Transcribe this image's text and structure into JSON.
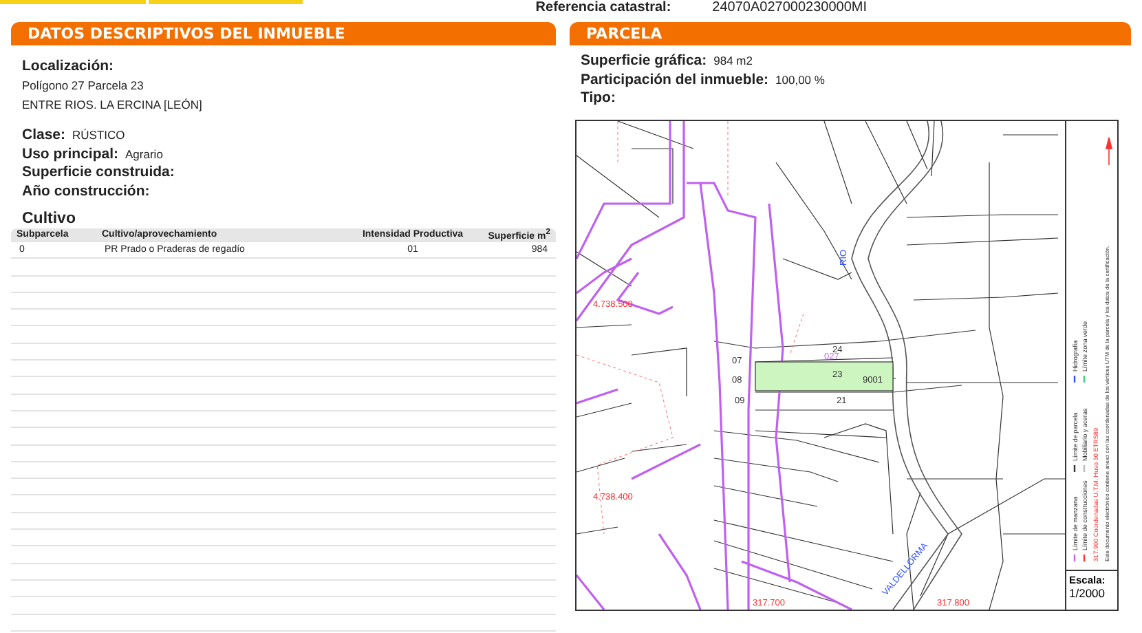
{
  "header": {
    "reference_label": "Referencia catastral:",
    "reference_value": "24070A027000230000MI"
  },
  "left_panel": {
    "title": "DATOS DESCRIPTIVOS DEL",
    "title_bold": "INMUEBLE",
    "location_label": "Localización:",
    "location_lines": [
      "Polígono 27 Parcela 23",
      "ENTRE RIOS. LA ERCINA [LEÓN]"
    ],
    "fields": [
      {
        "label": "Clase:",
        "value": "RÚSTICO"
      },
      {
        "label": "Uso principal:",
        "value": "Agrario"
      },
      {
        "label": "Superficie construida:"
      },
      {
        "label": "Año construcción:"
      }
    ],
    "cultivo": {
      "title": "Cultivo",
      "columns": [
        "Subparcela",
        "Cultivo/aprovechamiento",
        "Intensidad Productiva",
        "Superficie m$^{2}$"
      ],
      "rows": [
        [
          "0",
          "PR Prado o Praderas de regadío",
          "01",
          "984"
        ]
      ]
    }
  },
  "right_panel": {
    "title": "PARCELA",
    "fields": [
      {
        "label": "Superficie gráfica:",
        "value": "984 m2"
      },
      {
        "label": "Participación del inmueble:",
        "value": "100,00 %"
      },
      {
        "label": "Tipo:"
      }
    ],
    "map": {
      "labels": [
        "24",
        "23",
        "21",
        "07",
        "08",
        "09",
        "9001",
        "027",
        "RIO",
        "4.738.500",
        "4.738.400",
        "317.700",
        "317.800",
        "VALDELLORMA"
      ],
      "legend": [
        "Límite de manzana",
        "Límite de construcciones",
        "Límite de parcela",
        "Mobiliario y aceras",
        "Hidrografía",
        "Límite zona verde"
      ],
      "coordinates_note": "317.900 Coordenadas U.T.M. Huso 30 ETRS89",
      "document_note": "Este documento electrónico contiene anexo con las coordenadas de los vértices UTM de la parcela y los datos de la certificación.",
      "scale_label": "Escala:",
      "scale_value": "1/2000"
    }
  }
}
